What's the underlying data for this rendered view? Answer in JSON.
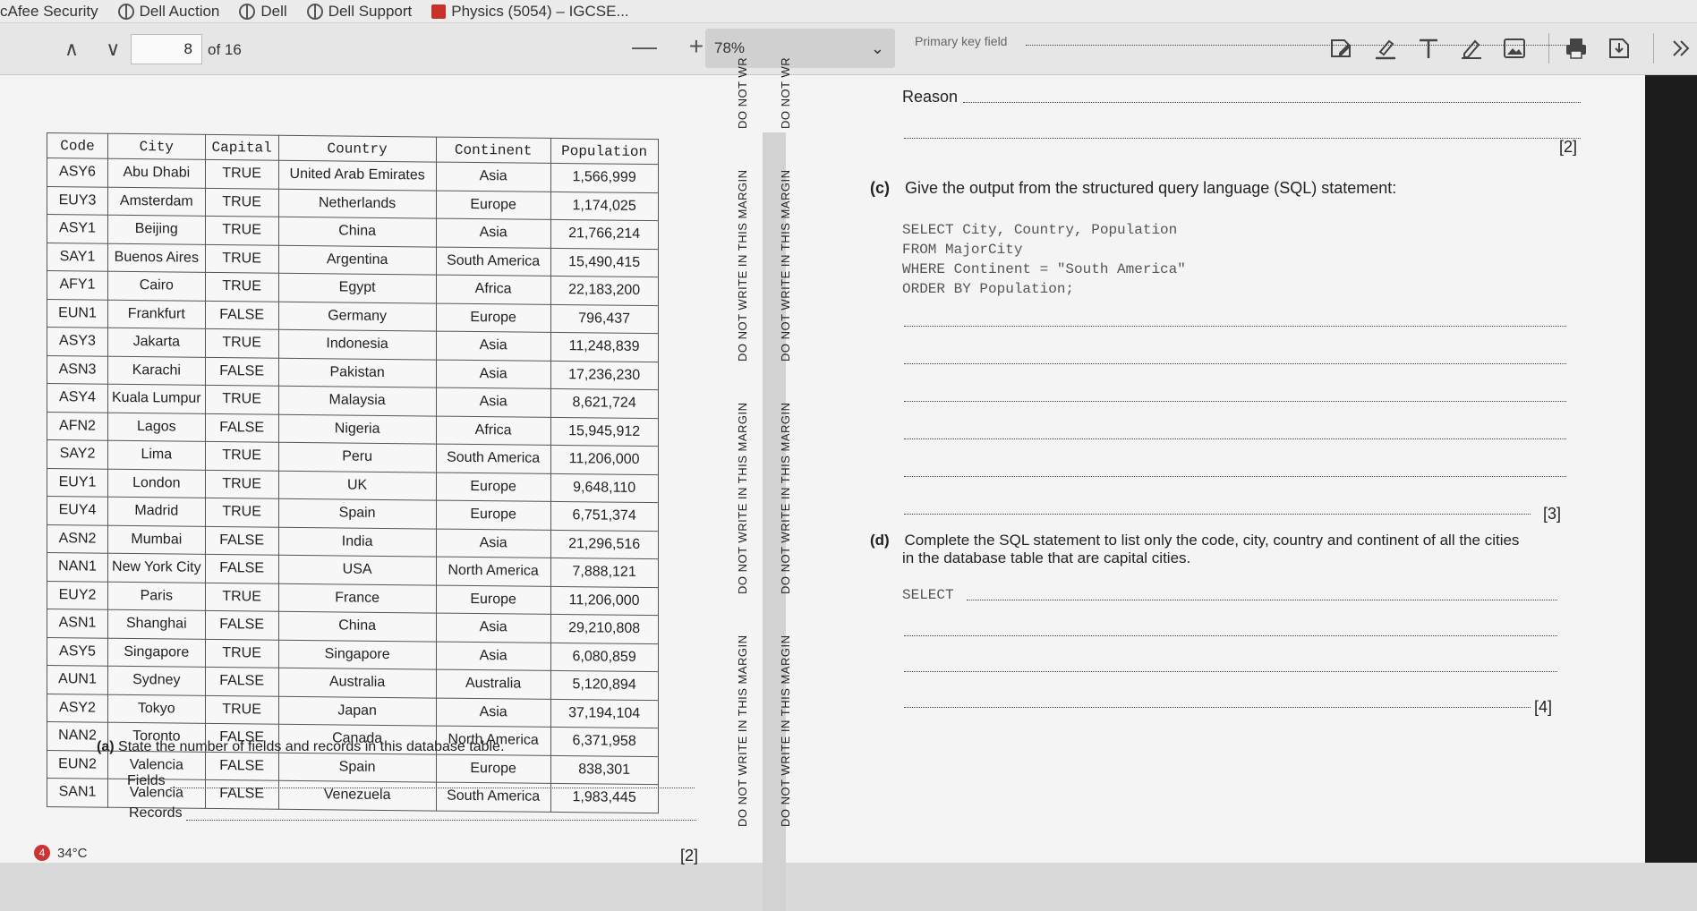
{
  "bookmarks": [
    {
      "label": "cAfee Security",
      "icon": "none"
    },
    {
      "label": "Dell Auction",
      "icon": "globe"
    },
    {
      "label": "Dell",
      "icon": "globe"
    },
    {
      "label": "Dell Support",
      "icon": "globe"
    },
    {
      "label": "Physics (5054) – IGCSE...",
      "icon": "red"
    }
  ],
  "toolbar": {
    "prev_icon": "∧",
    "next_icon": "∨",
    "page_number": "8",
    "page_total": "of 16",
    "zoom_out": "—",
    "zoom_in": "+",
    "zoom_level": "78%",
    "zoom_dropdown_icon": "⌄",
    "tools": [
      "draw-icon",
      "highlight-icon",
      "text-icon",
      "pen-icon",
      "image-icon",
      "print-icon",
      "save-icon",
      "more-icon"
    ]
  },
  "table": {
    "headers": [
      "Code",
      "City",
      "Capital",
      "Country",
      "Continent",
      "Population"
    ],
    "rows": [
      [
        "ASY6",
        "Abu Dhabi",
        "TRUE",
        "United Arab Emirates",
        "Asia",
        "1,566,999"
      ],
      [
        "EUY3",
        "Amsterdam",
        "TRUE",
        "Netherlands",
        "Europe",
        "1,174,025"
      ],
      [
        "ASY1",
        "Beijing",
        "TRUE",
        "China",
        "Asia",
        "21,766,214"
      ],
      [
        "SAY1",
        "Buenos Aires",
        "TRUE",
        "Argentina",
        "South America",
        "15,490,415"
      ],
      [
        "AFY1",
        "Cairo",
        "TRUE",
        "Egypt",
        "Africa",
        "22,183,200"
      ],
      [
        "EUN1",
        "Frankfurt",
        "FALSE",
        "Germany",
        "Europe",
        "796,437"
      ],
      [
        "ASY3",
        "Jakarta",
        "TRUE",
        "Indonesia",
        "Asia",
        "11,248,839"
      ],
      [
        "ASN3",
        "Karachi",
        "FALSE",
        "Pakistan",
        "Asia",
        "17,236,230"
      ],
      [
        "ASY4",
        "Kuala Lumpur",
        "TRUE",
        "Malaysia",
        "Asia",
        "8,621,724"
      ],
      [
        "AFN2",
        "Lagos",
        "FALSE",
        "Nigeria",
        "Africa",
        "15,945,912"
      ],
      [
        "SAY2",
        "Lima",
        "TRUE",
        "Peru",
        "South America",
        "11,206,000"
      ],
      [
        "EUY1",
        "London",
        "TRUE",
        "UK",
        "Europe",
        "9,648,110"
      ],
      [
        "EUY4",
        "Madrid",
        "TRUE",
        "Spain",
        "Europe",
        "6,751,374"
      ],
      [
        "ASN2",
        "Mumbai",
        "FALSE",
        "India",
        "Asia",
        "21,296,516"
      ],
      [
        "NAN1",
        "New York City",
        "FALSE",
        "USA",
        "North America",
        "7,888,121"
      ],
      [
        "EUY2",
        "Paris",
        "TRUE",
        "France",
        "Europe",
        "11,206,000"
      ],
      [
        "ASN1",
        "Shanghai",
        "FALSE",
        "China",
        "Asia",
        "29,210,808"
      ],
      [
        "ASY5",
        "Singapore",
        "TRUE",
        "Singapore",
        "Asia",
        "6,080,859"
      ],
      [
        "AUN1",
        "Sydney",
        "FALSE",
        "Australia",
        "Australia",
        "5,120,894"
      ],
      [
        "ASY2",
        "Tokyo",
        "TRUE",
        "Japan",
        "Asia",
        "37,194,104"
      ],
      [
        "NAN2",
        "Toronto",
        "FALSE",
        "Canada",
        "North America",
        "6,371,958"
      ],
      [
        "EUN2",
        "Valencia",
        "FALSE",
        "Spain",
        "Europe",
        "838,301"
      ],
      [
        "SAN1",
        "Valencia",
        "FALSE",
        "Venezuela",
        "South America",
        "1,983,445"
      ]
    ]
  },
  "question_a": {
    "label": "(a)",
    "text": "State the number of fields and records in this database table.",
    "fields_label": "Fields",
    "records_label": "Records",
    "marks": "[2]"
  },
  "margin_text": "DO NOT WRITE IN THIS MARGIN",
  "margin_text_short": "DO NOT WR",
  "right_page": {
    "top_partial": "Primary key field",
    "reason_label": "Reason",
    "marks_b": "[2]",
    "qc_label": "(c)",
    "qc_text": "Give the output from the structured query language (SQL) statement:",
    "sql_c": "SELECT City, Country, Population\nFROM MajorCity\nWHERE Continent = \"South America\"\nORDER BY Population;",
    "marks_c": "[3]",
    "qd_label": "(d)",
    "qd_text_1": "Complete the SQL statement to list only the code, city, country and continent of all the cities",
    "qd_text_2": "in the database table that are capital cities.",
    "sql_d_start": "SELECT",
    "marks_d": "[4]"
  },
  "status": {
    "badge": "4",
    "temperature": "34°C"
  }
}
